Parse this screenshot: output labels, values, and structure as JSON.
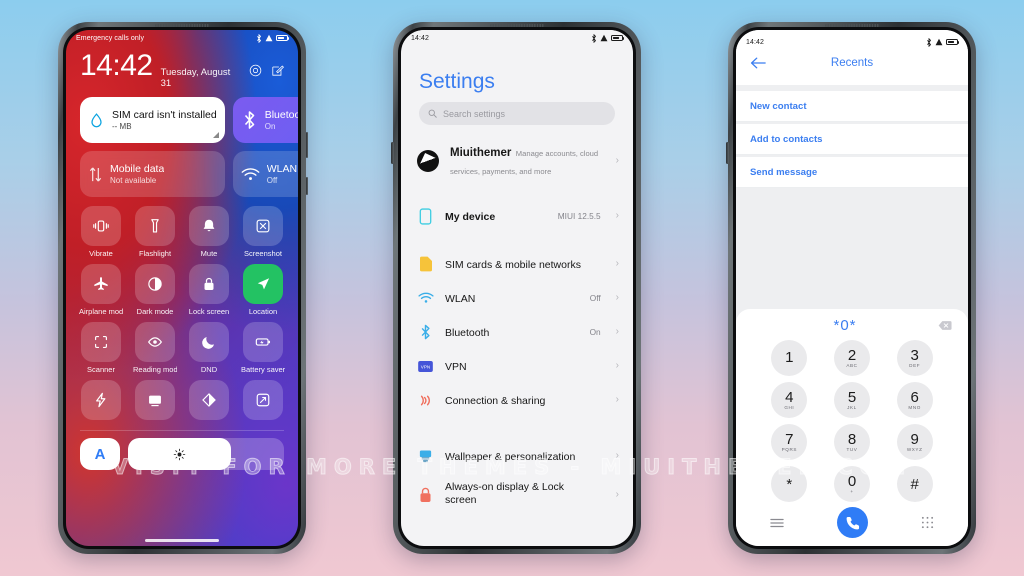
{
  "background": {
    "top_color": "#8ccdee",
    "bottom_color": "#f0c8d2"
  },
  "watermark": {
    "text": "VISIT FOR MORE THEMES - MIUITHEMER.COM"
  },
  "phone1": {
    "statusbar": {
      "carrier": "Emergency calls only",
      "time_hidden": "",
      "icons": [
        "bluetooth-icon",
        "warning-icon",
        "battery-icon"
      ]
    },
    "lockscreen": {
      "time": "14:42",
      "date": "Tuesday, August 31",
      "action_icons": [
        "camera-icon",
        "edit-icon"
      ]
    },
    "big_tiles": [
      {
        "title": "SIM card isn't installed",
        "subtitle": "-- MB",
        "icon": "data-drop-icon",
        "state": "off",
        "style": "white"
      },
      {
        "title": "Bluetooth",
        "subtitle": "On",
        "icon": "bluetooth-icon",
        "state": "on",
        "style": "purple"
      },
      {
        "title": "Mobile data",
        "subtitle": "Not available",
        "icon": "mobile-data-icon",
        "state": "off",
        "style": "dim"
      },
      {
        "title": "WLAN",
        "subtitle": "Off",
        "icon": "wifi-icon",
        "state": "off",
        "style": "dim"
      }
    ],
    "quick_tiles": [
      {
        "label": "Vibrate",
        "icon": "vibrate-icon",
        "active": false
      },
      {
        "label": "Flashlight",
        "icon": "flashlight-icon",
        "active": false
      },
      {
        "label": "Mute",
        "icon": "bell-icon",
        "active": false
      },
      {
        "label": "Screenshot",
        "icon": "screenshot-icon",
        "active": false
      },
      {
        "label": "Airplane mode",
        "icon": "airplane-icon",
        "active": false
      },
      {
        "label": "Dark mode",
        "icon": "contrast-icon",
        "active": false
      },
      {
        "label": "Lock screen",
        "icon": "lock-icon",
        "active": false
      },
      {
        "label": "Location",
        "icon": "location-arrow-icon",
        "active": true
      },
      {
        "label": "Scanner",
        "icon": "scan-frame-icon",
        "active": false
      },
      {
        "label": "Reading mode",
        "icon": "eye-icon",
        "active": false
      },
      {
        "label": "DND",
        "icon": "moon-icon",
        "active": false
      },
      {
        "label": "Battery saver",
        "icon": "battery-saver-icon",
        "active": false
      },
      {
        "label": "",
        "icon": "lightning-icon",
        "active": false
      },
      {
        "label": "",
        "icon": "cast-icon",
        "active": false
      },
      {
        "label": "",
        "icon": "half-circle-icon",
        "active": false
      },
      {
        "label": "",
        "icon": "expand-icon",
        "active": false
      }
    ],
    "brightness": {
      "auto_label": "A",
      "icon": "sun-icon",
      "level_percent": 66
    }
  },
  "phone2": {
    "statusbar": {
      "time": "14:42",
      "icons": [
        "bluetooth-icon",
        "warning-icon",
        "battery-icon"
      ]
    },
    "title": "Settings",
    "search": {
      "placeholder": "Search settings",
      "icon": "search-icon"
    },
    "account": {
      "name": "Miuithemer",
      "description": "Manage accounts, cloud services, payments, and more",
      "icon": "avatar"
    },
    "groups": [
      {
        "rows": [
          {
            "label": "My device",
            "value": "MIUI 12.5.5",
            "icon": "phone-outline-icon"
          }
        ]
      },
      {
        "rows": [
          {
            "label": "SIM cards & mobile networks",
            "value": "",
            "icon": "sim-card-icon"
          },
          {
            "label": "WLAN",
            "value": "Off",
            "icon": "wifi-icon"
          },
          {
            "label": "Bluetooth",
            "value": "On",
            "icon": "bluetooth-icon"
          },
          {
            "label": "VPN",
            "value": "",
            "icon": "vpn-icon"
          },
          {
            "label": "Connection & sharing",
            "value": "",
            "icon": "connection-share-icon"
          }
        ]
      },
      {
        "rows": [
          {
            "label": "Wallpaper & personalization",
            "value": "",
            "icon": "wallpaper-icon"
          },
          {
            "label": "Always-on display & Lock screen",
            "value": "",
            "icon": "lock-icon"
          }
        ]
      }
    ]
  },
  "phone3": {
    "statusbar": {
      "time": "14:42",
      "icons": [
        "bluetooth-icon",
        "warning-icon",
        "battery-icon"
      ]
    },
    "header": {
      "title": "Recents",
      "back_icon": "back-arrow-icon"
    },
    "options": [
      {
        "label": "New contact"
      },
      {
        "label": "Add to contacts"
      },
      {
        "label": "Send message"
      }
    ],
    "dialer": {
      "number": "*0*",
      "backspace_icon": "backspace-icon",
      "keys": [
        {
          "digit": "1",
          "letters": ""
        },
        {
          "digit": "2",
          "letters": "ABC"
        },
        {
          "digit": "3",
          "letters": "DEF"
        },
        {
          "digit": "4",
          "letters": "GHI"
        },
        {
          "digit": "5",
          "letters": "JKL"
        },
        {
          "digit": "6",
          "letters": "MNO"
        },
        {
          "digit": "7",
          "letters": "PQRS"
        },
        {
          "digit": "8",
          "letters": "TUV"
        },
        {
          "digit": "9",
          "letters": "WXYZ"
        },
        {
          "digit": "*",
          "letters": ""
        },
        {
          "digit": "0",
          "letters": "+"
        },
        {
          "digit": "#",
          "letters": ""
        }
      ],
      "bottom": {
        "menu_icon": "menu-lines-icon",
        "call_icon": "phone-call-icon",
        "keypad_icon": "keypad-dots-icon"
      }
    }
  }
}
